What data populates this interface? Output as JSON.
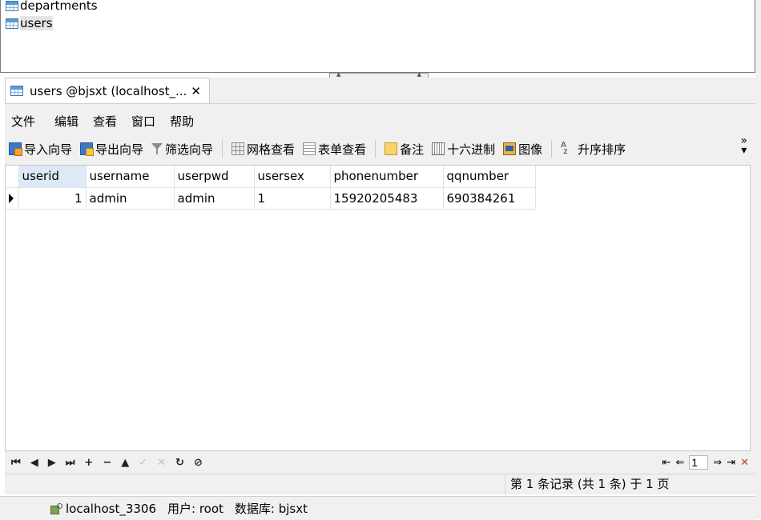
{
  "tree": {
    "items": [
      {
        "label": "departments",
        "icon": "table-icon",
        "selected": false
      },
      {
        "label": "users",
        "icon": "table-icon",
        "selected": true
      }
    ]
  },
  "tab": {
    "title": "users @bjsxt (localhost_...",
    "close": "✕"
  },
  "menu": {
    "items": [
      "文件",
      "编辑",
      "查看",
      "窗口",
      "帮助"
    ]
  },
  "toolbar": {
    "import": "导入向导",
    "export": "导出向导",
    "filter": "筛选向导",
    "grid_view": "网格查看",
    "form_view": "表单查看",
    "memo": "备注",
    "hex": "十六进制",
    "image": "图像",
    "sort": "升序排序",
    "more": "»"
  },
  "grid": {
    "columns": [
      "userid",
      "username",
      "userpwd",
      "usersex",
      "phonenumber",
      "qqnumber"
    ],
    "rows": [
      [
        "1",
        "admin",
        "admin",
        "1",
        "15920205483",
        "690384261"
      ]
    ]
  },
  "navigation": {
    "first": "⏮",
    "prev": "◀",
    "next": "▶",
    "last": "⏭",
    "add": "+",
    "delete": "−",
    "up": "▲",
    "apply": "✓",
    "cancel": "✕",
    "refresh": "↻",
    "stop": "⊘",
    "page": "1"
  },
  "record_info": "第 1 条记录 (共 1 条) 于 1 页",
  "status": {
    "connection": "localhost_3306",
    "user": "用户: root",
    "database": "数据库: bjsxt"
  },
  "colors": {
    "selected_header": "#dde9f6",
    "table_icon": "#5b9bd5"
  }
}
